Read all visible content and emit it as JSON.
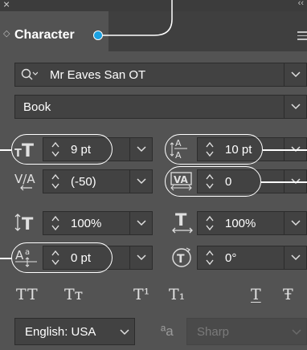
{
  "window": {
    "close_glyph": "×",
    "collapse_glyph": "‹‹"
  },
  "panel": {
    "title": "Character",
    "tab_toggle_glyph": "◇"
  },
  "font_family": {
    "value": "Mr Eaves San OT"
  },
  "font_style": {
    "value": "Book"
  },
  "size": {
    "value": "9 pt"
  },
  "leading": {
    "value": "10 pt"
  },
  "kerning": {
    "value": "(-50)"
  },
  "tracking": {
    "value": "0"
  },
  "vertical_scale": {
    "value": "100%"
  },
  "horizontal_scale": {
    "value": "100%"
  },
  "baseline_shift": {
    "value": "0 pt"
  },
  "character_rotation": {
    "value": "0°"
  },
  "type_buttons": {
    "all_caps": "TT",
    "small_caps": "Tт",
    "superscript": "T¹",
    "subscript": "T₁",
    "underline": "T",
    "strikethrough": "Ŧ"
  },
  "language": {
    "value": "English: USA"
  },
  "antialias": {
    "label": "ªa",
    "value": "Sharp"
  },
  "colors": {
    "panel": "#535353",
    "field": "#424242",
    "accent": "#1ba1e2",
    "annotation": "#ffffff"
  }
}
